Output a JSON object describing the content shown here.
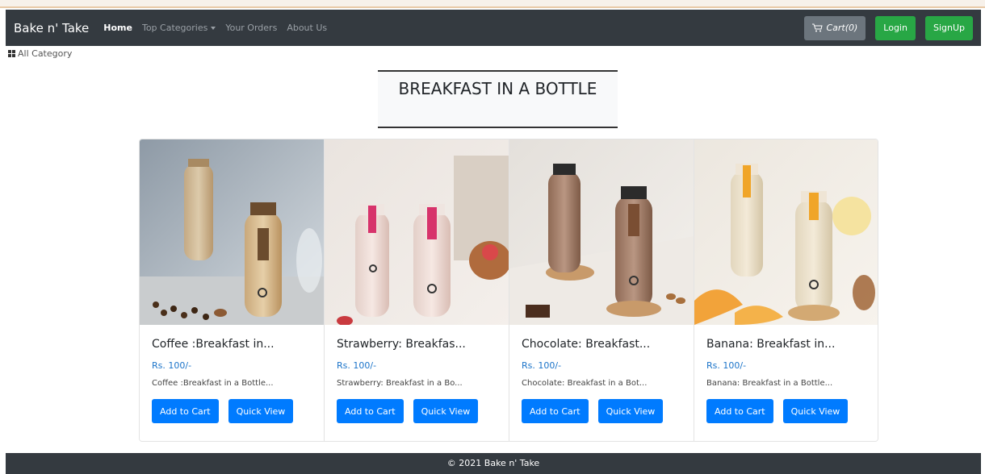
{
  "navbar": {
    "brand": "Bake n' Take",
    "links": [
      "Home",
      "Top Categories",
      "Your Orders",
      "About Us"
    ],
    "cart_label": "Cart(0)",
    "login_label": "Login",
    "signup_label": "SignUp"
  },
  "all_category_label": "All Category",
  "section_title": "BREAKFAST IN A BOTTLE",
  "products": [
    {
      "title": "Coffee :Breakfast in...",
      "price": "Rs. 100/-",
      "description": "Coffee :Breakfast in a Bottle...",
      "add_label": "Add to Cart",
      "quick_label": "Quick View"
    },
    {
      "title": "Strawberry: Breakfas...",
      "price": "Rs. 100/-",
      "description": "Strawberry: Breakfast in a Bo...",
      "add_label": "Add to Cart",
      "quick_label": "Quick View"
    },
    {
      "title": "Chocolate: Breakfast...",
      "price": "Rs. 100/-",
      "description": "Chocolate: Breakfast in a Bot...",
      "add_label": "Add to Cart",
      "quick_label": "Quick View"
    },
    {
      "title": "Banana: Breakfast in...",
      "price": "Rs. 100/-",
      "description": "Banana: Breakfast in a Bottle...",
      "add_label": "Add to Cart",
      "quick_label": "Quick View"
    }
  ],
  "footer_text": "© 2021 Bake n' Take",
  "colors": {
    "navbar": "#343a40",
    "primary": "#007bff",
    "success": "#28a745",
    "secondary": "#6c757d",
    "price": "#1a73c9"
  }
}
